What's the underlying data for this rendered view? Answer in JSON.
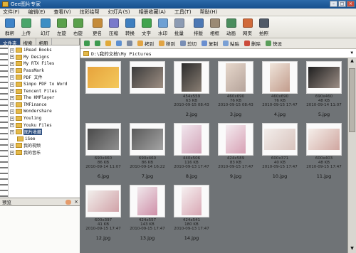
{
  "window": {
    "title": "Gee图片专家"
  },
  "menu": [
    "文件(F)",
    "编辑(E)",
    "查看(V)",
    "炫彩绘帮",
    "幻灯片(S)",
    "相册收藏(A)",
    "工具(T)",
    "帮助(H)"
  ],
  "toolbar": [
    {
      "label": "群帮",
      "icon": "group-icon",
      "color": "#3f84c8"
    },
    {
      "label": "上传",
      "icon": "upload-icon",
      "color": "#4aa56a"
    },
    {
      "label": "幻灯",
      "icon": "slideshow-icon",
      "color": "#3c8ec4"
    },
    {
      "label": "左旋",
      "icon": "rotate-left-icon",
      "color": "#5aa04b"
    },
    {
      "label": "右旋",
      "icon": "rotate-right-icon",
      "color": "#5aa04b"
    },
    {
      "label": "更名",
      "icon": "rename-icon",
      "color": "#c48b3a"
    },
    {
      "label": "压缩",
      "icon": "compress-icon",
      "color": "#7a7acb"
    },
    {
      "label": "转换",
      "icon": "convert-icon",
      "color": "#3f7fbf"
    },
    {
      "label": "文字",
      "icon": "text-icon",
      "color": "#41a34d"
    },
    {
      "label": "水印",
      "icon": "watermark-icon",
      "color": "#6ea0d4"
    },
    {
      "label": "批量",
      "icon": "batch-icon",
      "color": "#8c9bb3"
    },
    {
      "label": "排版",
      "icon": "layout-icon",
      "color": "#4c78b4"
    },
    {
      "label": "相框",
      "icon": "frame-icon",
      "color": "#9b8a74"
    },
    {
      "label": "动画",
      "icon": "animation-icon",
      "color": "#4a8d5d"
    },
    {
      "label": "网页",
      "icon": "webpage-icon",
      "color": "#d06a3a"
    },
    {
      "label": "拍照",
      "icon": "camera-icon",
      "color": "#505a68"
    }
  ],
  "left_panel": {
    "tabs": [
      "文件夹",
      "搜索",
      "相册"
    ],
    "tree": [
      {
        "label": "iRead Books",
        "expander": "+"
      },
      {
        "label": "My Designs",
        "expander": "+"
      },
      {
        "label": "My RTX Files",
        "expander": "+"
      },
      {
        "label": "PassMark",
        "expander": "+"
      },
      {
        "label": "PDF 文件",
        "expander": "+"
      },
      {
        "label": "Simpo PDF to Word",
        "expander": "+"
      },
      {
        "label": "Tencent Files",
        "expander": "+"
      },
      {
        "label": "The KMPlayer",
        "expander": "+"
      },
      {
        "label": "TMFinance",
        "expander": "+"
      },
      {
        "label": "Wondershare",
        "expander": "+"
      },
      {
        "label": "Youling",
        "expander": "+"
      },
      {
        "label": "Youku Files",
        "expander": "+"
      },
      {
        "label": "图片收藏",
        "expander": "+",
        "selected": true
      },
      {
        "label": "iSee",
        "expander": ""
      },
      {
        "label": "我的视频",
        "expander": "+"
      },
      {
        "label": "我的音乐",
        "expander": "+"
      }
    ],
    "preview_label": "预览"
  },
  "nav": {
    "buttons": [
      "拷到",
      "移到",
      "剪切",
      "复制",
      "粘贴",
      "删除",
      "快设"
    ]
  },
  "address": {
    "path": "D:\\我的文档\\My Pictures"
  },
  "thumbnails": [
    {
      "name": "",
      "info": [],
      "img_colors": [
        "#e7a33c",
        "#f3c95c"
      ]
    },
    {
      "name": "",
      "info": [],
      "img_colors": [
        "#3b3b3b",
        "#9e8f83"
      ]
    },
    {
      "name": "2.jpg",
      "info": [
        "454x559",
        "63 KB",
        "2010-09-15 08:43"
      ],
      "img_colors": [
        "#2b2b2b",
        "#8a7f74"
      ]
    },
    {
      "name": "3.jpg",
      "info": [
        "460x690",
        "76 KB",
        "2010-09-15 08:43"
      ],
      "img_colors": [
        "#e7d8cc",
        "#b5a39a"
      ]
    },
    {
      "name": "4.jpg",
      "info": [
        "460x690",
        "76 KB",
        "2010-09-15 17:47"
      ],
      "img_colors": [
        "#efe4da",
        "#c29c8c"
      ]
    },
    {
      "name": "5.jpg",
      "info": [
        "690x460",
        "48 KB",
        "2010-09-14 11:07"
      ],
      "img_colors": [
        "#1f1f1f",
        "#9c8e86"
      ]
    },
    {
      "name": "6.jpg",
      "info": [
        "690x460",
        "86 KB",
        "2010-09-14 11:07"
      ],
      "img_colors": [
        "#4a4a4a",
        "#8f8f8f"
      ]
    },
    {
      "name": "7.jpg",
      "info": [
        "690x460",
        "86 KB",
        "2010-09-14 16:22"
      ],
      "img_colors": [
        "#5a5a5a",
        "#a4a4a4"
      ]
    },
    {
      "name": "8.jpg",
      "info": [
        "440x506",
        "116 KB",
        "2010-09-13 17:47"
      ],
      "img_colors": [
        "#f1e7ee",
        "#d3a4b8"
      ]
    },
    {
      "name": "9.jpg",
      "info": [
        "424x589",
        "83 KB",
        "2010-09-15 17:47"
      ],
      "img_colors": [
        "#f4ecf0",
        "#d7a0b4"
      ]
    },
    {
      "name": "10.jpg",
      "info": [
        "600x371",
        "40 KB",
        "2010-09-15 17:47"
      ],
      "img_colors": [
        "#f3eeeb",
        "#d8c3bd"
      ]
    },
    {
      "name": "11.jpg",
      "info": [
        "600x403",
        "48 KB",
        "2010-09-15 17:47"
      ],
      "img_colors": [
        "#f5efea",
        "#d0a6a0"
      ]
    },
    {
      "name": "12.jpg",
      "info": [
        "600x397",
        "41 KB",
        "2010-09-15 17:47"
      ],
      "img_colors": [
        "#f2efec",
        "#d1a2a8"
      ]
    },
    {
      "name": "13.jpg",
      "info": [
        "424x557",
        "143 KB",
        "2010-09-15 17:47"
      ],
      "img_colors": [
        "#f0e8ec",
        "#cf8fa8"
      ]
    },
    {
      "name": "14.jpg",
      "info": [
        "424x541",
        "180 KB",
        "2010-09-13 17:47"
      ],
      "img_colors": [
        "#f6f1f1",
        "#d9a7b4"
      ]
    }
  ]
}
